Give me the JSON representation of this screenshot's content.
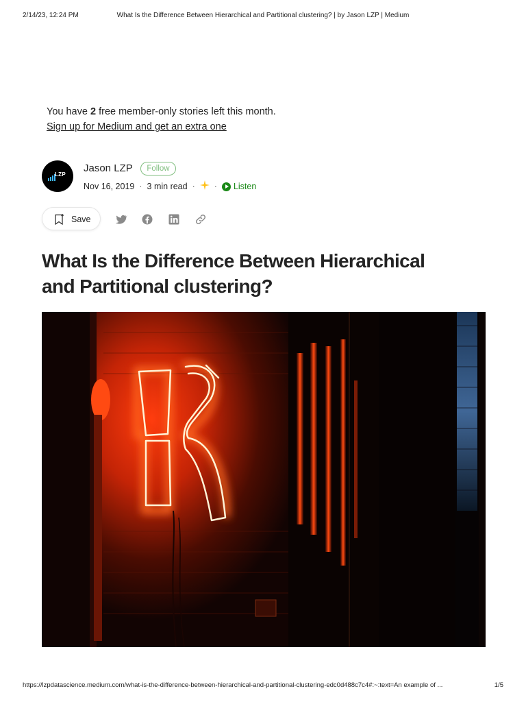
{
  "print_header": {
    "datetime": "2/14/23, 12:24 PM",
    "page_title": "What Is the Difference Between Hierarchical and Partitional clustering? | by Jason LZP | Medium"
  },
  "paywall": {
    "prefix": "You have",
    "count": "2",
    "suffix": "free member-only stories left this month.",
    "signup_link": "Sign up for Medium and get an extra one"
  },
  "author": {
    "avatar_text": "LZP",
    "name": "Jason LZP",
    "follow_label": "Follow",
    "date": "Nov 16, 2019",
    "read_time": "3 min read",
    "separator": "·",
    "listen_label": "Listen",
    "star_icon": "star-icon",
    "play_icon": "play-icon"
  },
  "actions": {
    "save_label": "Save",
    "icons": [
      "bookmark-icon",
      "twitter-icon",
      "facebook-icon",
      "linkedin-icon",
      "link-icon"
    ]
  },
  "article": {
    "title_line1": "What Is the Difference Between Hierarchical",
    "title_line2": "and Partitional clustering?"
  },
  "print_footer": {
    "url": "https://lzpdatascience.medium.com/what-is-the-difference-between-hierarchical-and-partitional-clustering-edc0d488c7c4#:~:text=An example of ...",
    "page": "1/5"
  },
  "colors": {
    "accent_green": "#1a8917",
    "text": "#242424",
    "muted": "#6b6b6b",
    "star": "#ffc017",
    "neon": "#ff5a1f"
  }
}
